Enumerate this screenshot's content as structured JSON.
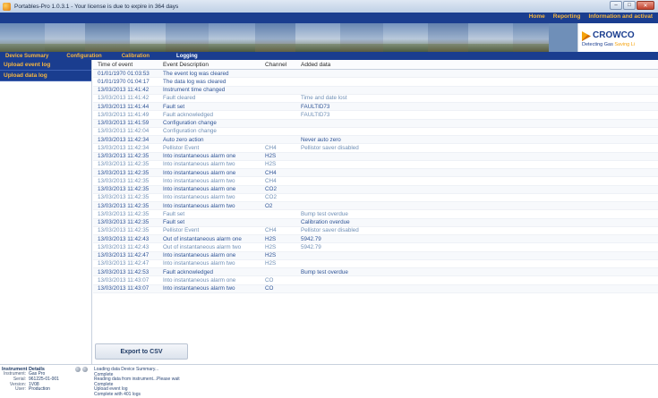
{
  "window": {
    "title": "Portables-Pro 1.0.3.1 - Your license is due to expire in 364 days"
  },
  "top_menu": [
    "Home",
    "Reporting",
    "Information and activat"
  ],
  "logo": {
    "brand": "CROWCO",
    "tagline_main": "Detecting Gas",
    "tagline_accent": "Saving Li"
  },
  "nav_tabs": [
    {
      "label": "Device Summary",
      "active": false
    },
    {
      "label": "Configuration",
      "active": false
    },
    {
      "label": "Calibration",
      "active": false
    },
    {
      "label": "Logging",
      "active": true
    }
  ],
  "sidebar": {
    "items": [
      "Upload event log",
      "Upload data log"
    ]
  },
  "table": {
    "headers": [
      "Time of event",
      "Event Description",
      "Channel",
      "Added data"
    ],
    "rows": [
      [
        "01/01/1970 01:03:53",
        "The event log was cleared",
        "",
        ""
      ],
      [
        "01/01/1970 01:04:17",
        "The data log was cleared",
        "",
        ""
      ],
      [
        "13/03/2013 11:41:42",
        "Instrument time changed",
        "",
        ""
      ],
      [
        "13/03/2013 11:41:42",
        "Fault cleared",
        "",
        "Time and date lost"
      ],
      [
        "13/03/2013 11:41:44",
        "Fault set",
        "",
        "FAULTID73"
      ],
      [
        "13/03/2013 11:41:49",
        "Fault acknowledged",
        "",
        "FAULTID73"
      ],
      [
        "13/03/2013 11:41:59",
        "Configuration change",
        "",
        ""
      ],
      [
        "13/03/2013 11:42:04",
        "Configuration change",
        "",
        ""
      ],
      [
        "13/03/2013 11:42:34",
        "Auto zero action",
        "",
        "Never auto zero"
      ],
      [
        "13/03/2013 11:42:34",
        "Pellistor Event",
        "CH4",
        "Pellistor saver disabled"
      ],
      [
        "13/03/2013 11:42:35",
        "Into instantaneous alarm one",
        "H2S",
        ""
      ],
      [
        "13/03/2013 11:42:35",
        "Into instantaneous alarm two",
        "H2S",
        ""
      ],
      [
        "13/03/2013 11:42:35",
        "Into instantaneous alarm one",
        "CH4",
        ""
      ],
      [
        "13/03/2013 11:42:35",
        "Into instantaneous alarm two",
        "CH4",
        ""
      ],
      [
        "13/03/2013 11:42:35",
        "Into instantaneous alarm one",
        "CO2",
        ""
      ],
      [
        "13/03/2013 11:42:35",
        "Into instantaneous alarm two",
        "CO2",
        ""
      ],
      [
        "13/03/2013 11:42:35",
        "Into instantaneous alarm two",
        "O2",
        ""
      ],
      [
        "13/03/2013 11:42:35",
        "Fault set",
        "",
        "Bump test overdue"
      ],
      [
        "13/03/2013 11:42:35",
        "Fault set",
        "",
        "Calibration overdue"
      ],
      [
        "13/03/2013 11:42:35",
        "Pellistor Event",
        "CH4",
        "Pellistor saver disabled"
      ],
      [
        "13/03/2013 11:42:43",
        "Out of instantaneous alarm one",
        "H2S",
        "5942.79"
      ],
      [
        "13/03/2013 11:42:43",
        "Out of instantaneous alarm two",
        "H2S",
        "5942.79"
      ],
      [
        "13/03/2013 11:42:47",
        "Into instantaneous alarm one",
        "H2S",
        ""
      ],
      [
        "13/03/2013 11:42:47",
        "Into instantaneous alarm two",
        "H2S",
        ""
      ],
      [
        "13/03/2013 11:42:53",
        "Fault acknowledged",
        "",
        "Bump test overdue"
      ],
      [
        "13/03/2013 11:43:07",
        "Into instantaneous alarm one",
        "CO",
        ""
      ],
      [
        "13/03/2013 11:43:07",
        "Into instantaneous alarm two",
        "CO",
        ""
      ]
    ]
  },
  "export_button": "Export to CSV",
  "instrument_details": {
    "title": "Instrument Details",
    "fields": [
      {
        "key": "Instrument:",
        "value": "Gas Pro"
      },
      {
        "key": "Serial:",
        "value": "961225-01-001"
      },
      {
        "key": "Version:",
        "value": "1V08"
      },
      {
        "key": "User:",
        "value": "Production"
      }
    ]
  },
  "status_log": [
    "Loading data Device Summary...",
    "Complete",
    "Reading data from instrument...Please wait",
    "Complete",
    "Upload event log",
    "Complete with 401 logs"
  ],
  "colors": {
    "nav_blue": "#1a3d8f",
    "nav_orange": "#f6b640",
    "row_text": "#2f5496"
  }
}
